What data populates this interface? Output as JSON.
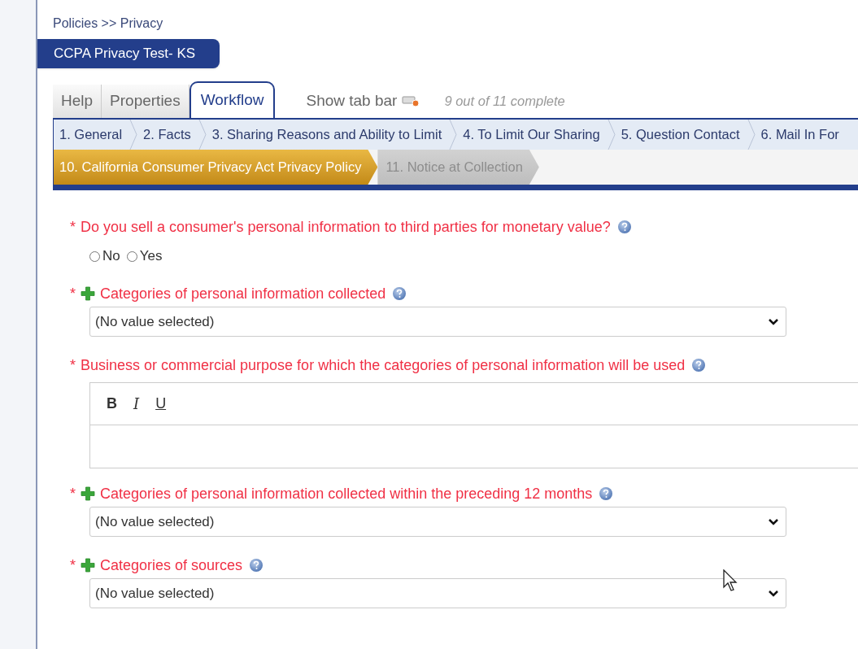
{
  "breadcrumb": "Policies >> Privacy",
  "title": "CCPA Privacy Test- KS",
  "tabs": [
    {
      "label": "Help",
      "selected": false
    },
    {
      "label": "Properties",
      "selected": false
    },
    {
      "label": "Workflow",
      "selected": true
    }
  ],
  "show_tab_bar": "Show tab bar",
  "progress": "9 out of 11 complete",
  "step_rows": [
    {
      "steps": [
        {
          "label": "1. General",
          "selected": false,
          "disabled": false
        },
        {
          "label": "2. Facts",
          "selected": false,
          "disabled": false
        },
        {
          "label": "3. Sharing Reasons and Ability to Limit",
          "selected": false,
          "disabled": false
        },
        {
          "label": "4. To Limit Our Sharing",
          "selected": false,
          "disabled": false
        },
        {
          "label": "5. Question Contact",
          "selected": false,
          "disabled": false
        },
        {
          "label": "6. Mail In For",
          "selected": false,
          "disabled": false
        }
      ]
    },
    {
      "steps": [
        {
          "label": "10. California Consumer Privacy Act Privacy Policy",
          "selected": true,
          "disabled": false
        },
        {
          "label": "11. Notice at Collection",
          "selected": false,
          "disabled": true
        }
      ]
    }
  ],
  "fields": [
    {
      "kind": "radio",
      "marker": "*",
      "addable": false,
      "help": true,
      "label": "Do you sell a consumer's personal information to third parties for monetary value?",
      "options": [
        {
          "label": "No",
          "selected": false
        },
        {
          "label": "Yes",
          "selected": false
        }
      ]
    },
    {
      "kind": "select",
      "marker": "*",
      "addable": true,
      "help": true,
      "label": "Categories of personal information collected",
      "value": "(No value selected)"
    },
    {
      "kind": "richtext",
      "marker": "*",
      "addable": false,
      "help": true,
      "label": "Business or commercial purpose for which the categories of personal information will be used",
      "toolbar": [
        {
          "kind": "bold",
          "label": "B"
        },
        {
          "kind": "italic",
          "label": "I"
        },
        {
          "kind": "underline",
          "label": "U"
        }
      ]
    },
    {
      "kind": "select",
      "marker": "*",
      "addable": true,
      "help": true,
      "label": "Categories of personal information collected within the preceding 12 months",
      "value": "(No value selected)"
    },
    {
      "kind": "select",
      "marker": "*",
      "addable": true,
      "help": true,
      "label": "Categories of sources",
      "value": "(No value selected)"
    }
  ]
}
